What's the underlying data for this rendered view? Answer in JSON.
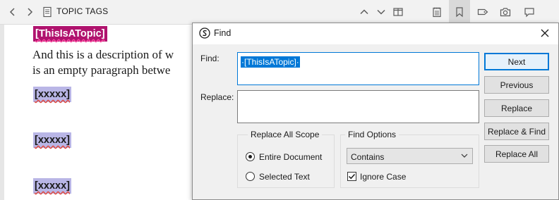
{
  "editor": {
    "doc_title": "TOPIC TAGS",
    "topic_tag": "[ThisIsATopic]",
    "description_line1": "And this is a description of w",
    "description_line2": "is an empty paragraph betwe",
    "placeholder_tags": [
      "[xxxxx]",
      "[xxxxx]",
      "[xxxxx]"
    ],
    "toolbar_icons": [
      "back-arrow-icon",
      "forward-arrow-icon",
      "document-icon",
      "chevron-up-icon",
      "chevron-down-icon",
      "split-view-icon",
      "notebook-icon",
      "bookmark-icon",
      "tag-icon",
      "camera-icon",
      "comment-icon"
    ]
  },
  "dialog": {
    "title": "Find",
    "find_label": "Find:",
    "find_value": "·[ThisIsATopic]·",
    "replace_label": "Replace:",
    "replace_value": "",
    "buttons": {
      "next": "Next",
      "previous": "Previous",
      "replace": "Replace",
      "replace_find": "Replace & Find",
      "replace_all": "Replace All"
    },
    "scope": {
      "title": "Replace All Scope",
      "entire_document": "Entire Document",
      "selected_text": "Selected Text",
      "selected": "entire_document"
    },
    "options": {
      "title": "Find Options",
      "match_mode": "Contains",
      "ignore_case_label": "Ignore Case",
      "ignore_case": true
    }
  },
  "colors": {
    "accent": "#0078d7",
    "topic_tag_bg": "#b0136e",
    "placeholder_tag_bg": "#b9b6e6"
  }
}
